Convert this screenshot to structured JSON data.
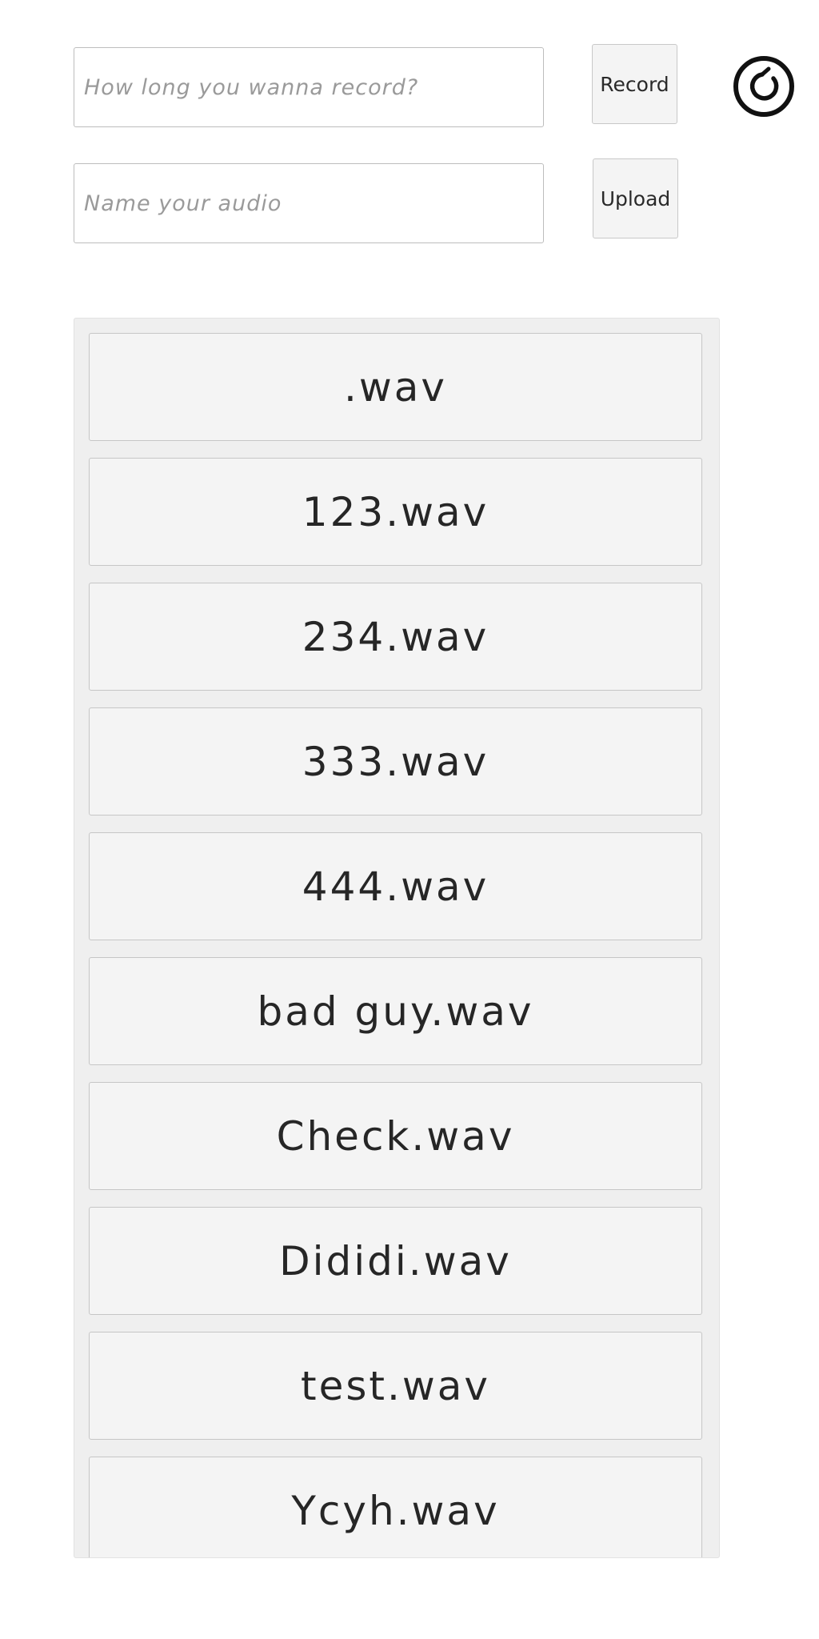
{
  "controls": {
    "duration_placeholder": "How long you wanna record?",
    "name_placeholder": "Name your audio",
    "record_label": "Record",
    "upload_label": "Upload",
    "refresh_icon": "refresh-icon"
  },
  "files": [
    ".wav",
    "123.wav",
    "234.wav",
    "333.wav",
    "444.wav",
    "bad guy.wav",
    "Check.wav",
    "Dididi.wav",
    "test.wav",
    "Ycyh.wav"
  ]
}
